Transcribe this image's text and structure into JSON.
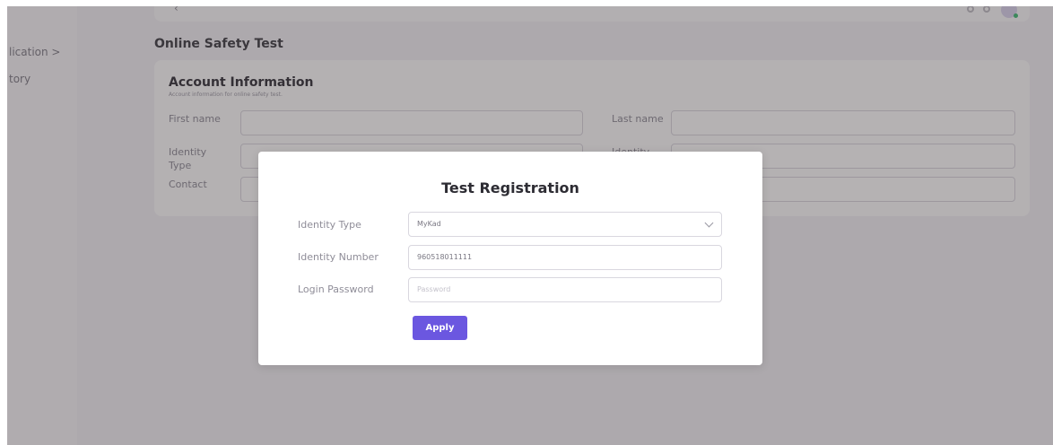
{
  "sidebar": {
    "items": [
      {
        "label": "lication >"
      },
      {
        "label": "tory"
      }
    ]
  },
  "topbar": {
    "back_icon": "chevron-left-icon"
  },
  "page": {
    "title": "Online Safety Test"
  },
  "account_card": {
    "title": "Account Information",
    "subtitle": "Account information for online safety test.",
    "fields": {
      "first_name": "First name",
      "last_name": "Last name",
      "identity_type": "Identity Type",
      "identity_right": "Identity",
      "contact": "Contact"
    }
  },
  "modal": {
    "title": "Test Registration",
    "identity_type": {
      "label": "Identity Type",
      "value": "MyKad"
    },
    "identity_number": {
      "label": "Identity Number",
      "value": "960518011111"
    },
    "login_password": {
      "label": "Login Password",
      "placeholder": "Password"
    },
    "apply_label": "Apply",
    "accent": "#6b57e0"
  }
}
